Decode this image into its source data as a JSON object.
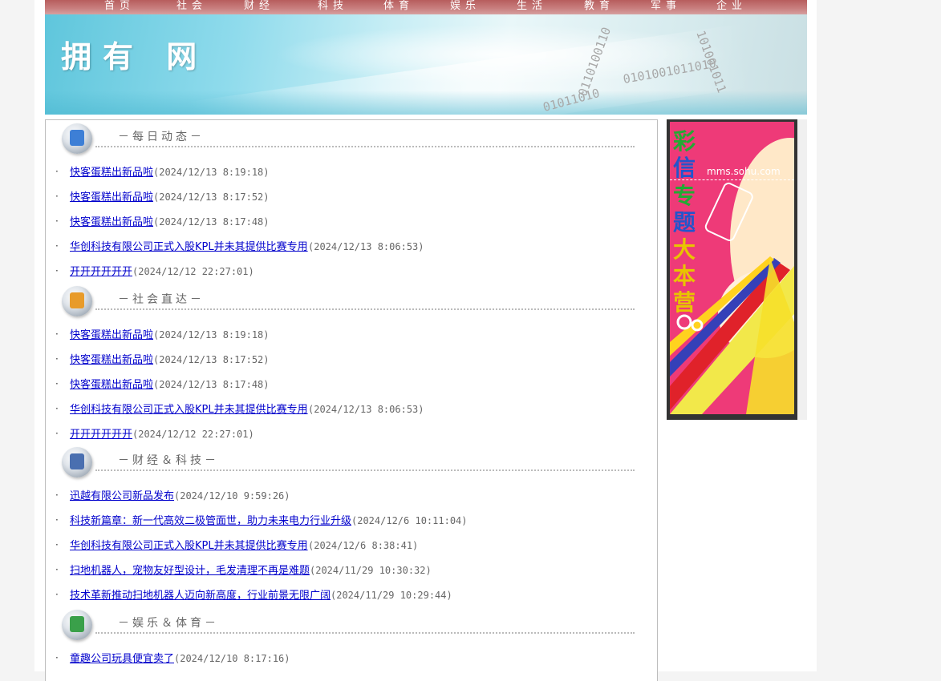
{
  "nav": [
    "首页",
    "社会",
    "财经",
    "科技",
    "体育",
    "娱乐",
    "生活",
    "教育",
    "军事",
    "企业"
  ],
  "banner": {
    "title": "拥有 网",
    "binary": [
      "0110100110",
      "0101001011010",
      "101001011",
      "01011010"
    ]
  },
  "sections": [
    {
      "title": "－每日动态－",
      "icon": "bell-icon",
      "items": [
        {
          "title": "快客蛋糕出新品啦",
          "time": "(2024/12/13 8:19:18)"
        },
        {
          "title": "快客蛋糕出新品啦",
          "time": "(2024/12/13 8:17:52)"
        },
        {
          "title": "快客蛋糕出新品啦",
          "time": "(2024/12/13 8:17:48)"
        },
        {
          "title": "华创科技有限公司正式入股KPL并未其提供比赛专用",
          "time": "(2024/12/13 8:06:53)"
        },
        {
          "title": "开开开开开开",
          "time": "(2024/12/12 22:27:01)"
        }
      ]
    },
    {
      "title": "－社会直达－",
      "icon": "folder-icon",
      "items": [
        {
          "title": "快客蛋糕出新品啦",
          "time": "(2024/12/13 8:19:18)"
        },
        {
          "title": "快客蛋糕出新品啦",
          "time": "(2024/12/13 8:17:52)"
        },
        {
          "title": "快客蛋糕出新品啦",
          "time": "(2024/12/13 8:17:48)"
        },
        {
          "title": "华创科技有限公司正式入股KPL并未其提供比赛专用",
          "time": "(2024/12/13 8:06:53)"
        },
        {
          "title": "开开开开开开",
          "time": "(2024/12/12 22:27:01)"
        }
      ]
    },
    {
      "title": "－财经＆科技－",
      "icon": "monitor-icon",
      "items": [
        {
          "title": "迅越有限公司新品发布",
          "time": "(2024/12/10 9:59:26)"
        },
        {
          "title": "科技新篇章：新一代高效二极管面世，助力未来电力行业升级",
          "time": "(2024/12/6 10:11:04)"
        },
        {
          "title": "华创科技有限公司正式入股KPL并未其提供比赛专用",
          "time": "(2024/12/6 8:38:41)"
        },
        {
          "title": "扫地机器人，宠物友好型设计，毛发清理不再是难题",
          "time": "(2024/11/29 10:30:32)"
        },
        {
          "title": "技术革新推动扫地机器人迈向新高度，行业前景无限广阔",
          "time": "(2024/11/29 10:29:44)"
        }
      ]
    },
    {
      "title": "－娱乐＆体育－",
      "icon": "globe-icon",
      "items": [
        {
          "title": "童趣公司玩具便宜卖了",
          "time": "(2024/12/10 8:17:16)"
        }
      ]
    }
  ],
  "ad": {
    "url": "mms.sohu.com",
    "chars": [
      "彩",
      "信",
      "专",
      "题",
      "大",
      "本",
      "营"
    ],
    "colors": [
      "#22aa33",
      "#2255cc",
      "#22aa33",
      "#2255cc",
      "#e8c400",
      "#e8c400",
      "#e8c400"
    ],
    "accent": "#ee3a78"
  },
  "colors": {
    "link": "#0000cc",
    "nav_bg": "#c06868"
  }
}
